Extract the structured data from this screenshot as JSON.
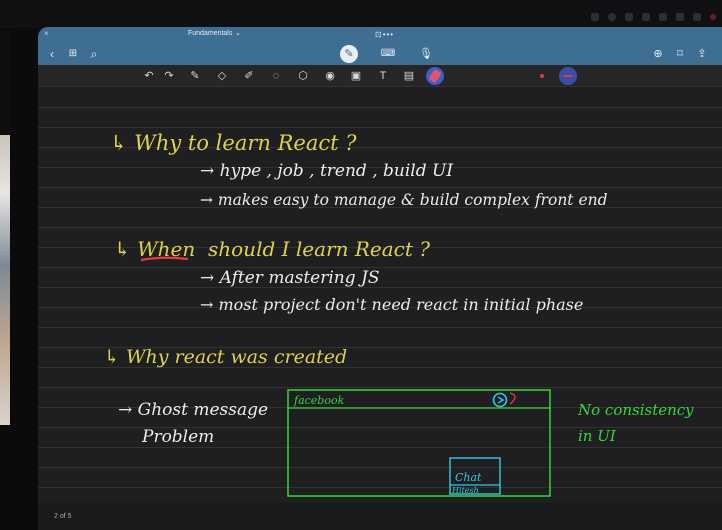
{
  "window": {
    "title": "Fundamentals",
    "page_indicator": "2 of 5"
  },
  "navbar_icons": [
    "back-icon",
    "grid-icon",
    "search-icon",
    "pen-icon",
    "keyboard-icon",
    "mic-icon",
    "add-page-icon",
    "bookmark-icon",
    "share-icon"
  ],
  "toolbar_icons": [
    "undo-icon",
    "redo-icon",
    "pen-icon",
    "eraser-icon",
    "highlighter-icon",
    "lasso-icon",
    "shapes-icon",
    "laser-icon",
    "image-icon",
    "text-icon",
    "sticker-icon",
    "active-pen-icon"
  ],
  "colors": {
    "title_bar": "#3e6e92",
    "ink_yellow": "#ddd24a",
    "ink_white": "#ececec",
    "ink_green": "#37d63a",
    "ink_cyan": "#38c8e0",
    "ink_red": "#e23c3c"
  },
  "notes": {
    "line1": "↳ Why to learn React ?",
    "line2": "→ hype , job , trend , build UI",
    "line3": "→ makes easy to manage & build complex front end",
    "line4a": "↳ When",
    "line4b": "should I learn React ?",
    "line5": "→ After mastering JS",
    "line6": "→ most project don't need react in initial phase",
    "line7": "↳ Why react was created",
    "line8": "→ Ghost message",
    "line9": "Problem",
    "box_title": "facebook",
    "chat_label": "Chat",
    "chat_name": "Hitesh",
    "side1": "No consistency",
    "side2": "in UI"
  }
}
